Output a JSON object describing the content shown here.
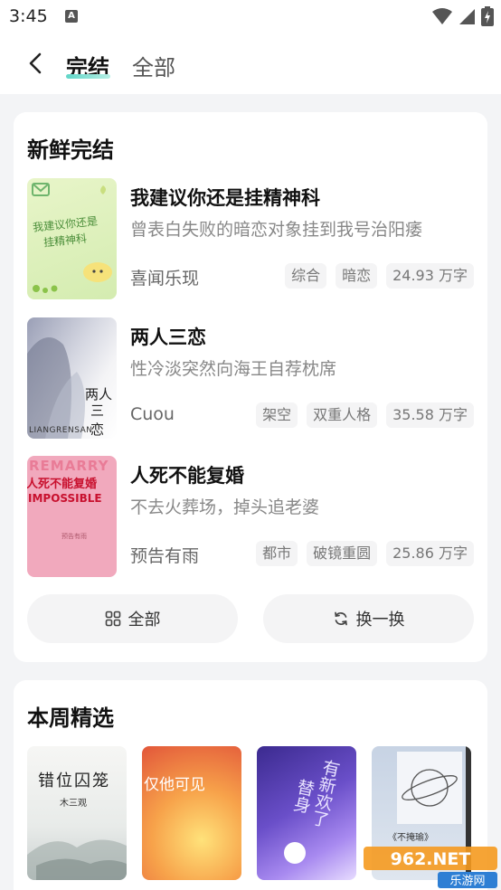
{
  "status_bar": {
    "time": "3:45",
    "notif_letter": "A"
  },
  "header": {
    "tab_active": "完结",
    "tab_inactive": "全部"
  },
  "fresh": {
    "title": "新鲜完结",
    "books": [
      {
        "title": "我建议你还是挂精神科",
        "desc": "曾表白失败的暗恋对象挂到我号治阳痿",
        "author": "喜闻乐现",
        "tags": [
          "综合",
          "暗恋",
          "24.93 万字"
        ],
        "cover_text": [
          "我建议你还是",
          "挂精神科"
        ]
      },
      {
        "title": "两人三恋",
        "desc": "性冷淡突然向海王自荐枕席",
        "author": "Cuou",
        "tags": [
          "架空",
          "双重人格",
          "35.58 万字"
        ],
        "cover_text": [
          "两人",
          "三恋",
          "LIANGRENSAN"
        ]
      },
      {
        "title": "人死不能复婚",
        "desc": "不去火葬场，掉头追老婆",
        "author": "预告有雨",
        "tags": [
          "都市",
          "破镜重圆",
          "25.86 万字"
        ],
        "cover_text": [
          "REMARRY",
          "人死不能复婚",
          "IMPOSSIBLE",
          "预告有雨"
        ]
      }
    ],
    "btn_all": "全部",
    "btn_swap": "换一换"
  },
  "weekly": {
    "title": "本周精选",
    "covers": [
      {
        "text": [
          "错位囚笼",
          "木三观"
        ]
      },
      {
        "text": [
          "仅他可见"
        ]
      },
      {
        "text": [
          "有新欢了",
          "替身"
        ]
      },
      {
        "text": [
          "《不掩瑜》"
        ]
      }
    ]
  },
  "watermark": {
    "text": "962.NET",
    "sub": "乐游网"
  },
  "colors": {
    "accent": "#61d6c8",
    "background": "#f3f4f6"
  }
}
